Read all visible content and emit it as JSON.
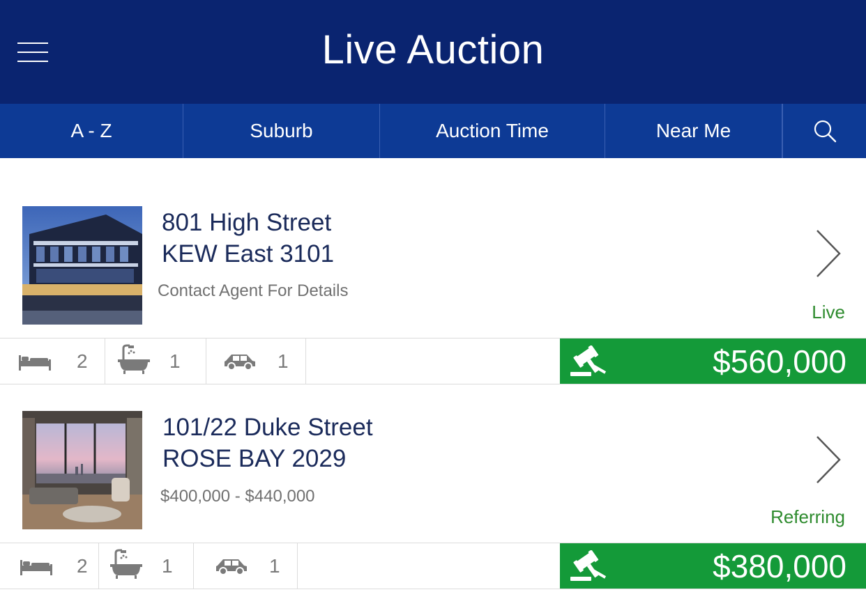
{
  "header": {
    "title": "Live Auction",
    "menu_icon": "hamburger-menu-icon"
  },
  "filters": {
    "tabs": [
      "A - Z",
      "Suburb",
      "Auction Time",
      "Near Me"
    ],
    "search_icon": "search-icon"
  },
  "listings": [
    {
      "address_line1": "801 High Street",
      "address_line2": "KEW East 3101",
      "price_guide": "Contact Agent For Details",
      "status": "Live",
      "beds": "2",
      "baths": "1",
      "cars": "1",
      "bid_amount": "$560,000"
    },
    {
      "address_line1": "101/22 Duke Street",
      "address_line2": "ROSE BAY 2029",
      "price_guide": "$400,000 - $440,000",
      "status": "Referring",
      "beds": "2",
      "baths": "1",
      "cars": "1",
      "bid_amount": "$380,000"
    }
  ],
  "colors": {
    "header_bg": "#0a2470",
    "filter_bg": "#0d3a95",
    "bid_bg": "#149a39",
    "status_green": "#2e8b2e"
  }
}
